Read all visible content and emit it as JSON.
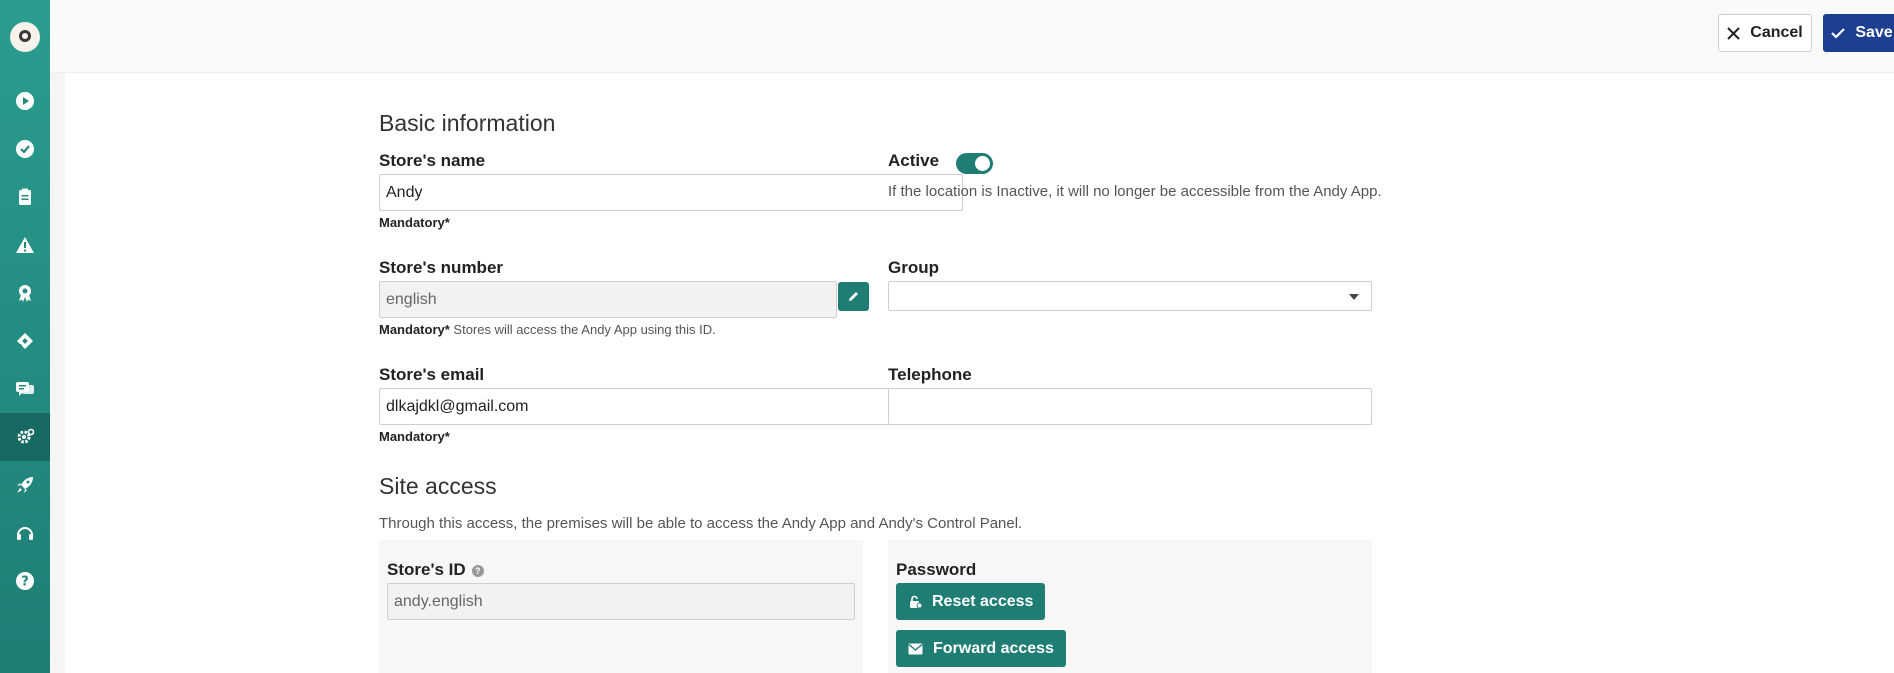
{
  "sidebar": {
    "logo_icon": "dog-logo-icon",
    "items": [
      {
        "name": "play-icon",
        "active": false
      },
      {
        "name": "check-circle-icon",
        "active": false
      },
      {
        "name": "clipboard-icon",
        "active": false
      },
      {
        "name": "warning-icon",
        "active": false
      },
      {
        "name": "award-icon",
        "active": false
      },
      {
        "name": "ticket-icon",
        "active": false
      },
      {
        "name": "chat-icon",
        "active": false
      },
      {
        "name": "gear-icon",
        "active": true
      },
      {
        "name": "rocket-icon",
        "active": false
      },
      {
        "name": "headset-icon",
        "active": false
      },
      {
        "name": "help-icon",
        "active": false
      }
    ]
  },
  "toolbar": {
    "cancel_label": "Cancel",
    "save_label": "Save"
  },
  "basic_info": {
    "title": "Basic information",
    "store_name": {
      "label": "Store's name",
      "value": "Andy",
      "helper": "Mandatory*"
    },
    "active": {
      "label": "Active",
      "enabled": true,
      "hint": "If the location is Inactive, it will no longer be accessible from the Andy App."
    },
    "store_number": {
      "label": "Store's number",
      "value": "english",
      "helper_bold": "Mandatory*",
      "helper_rest": " Stores will access the Andy App using this ID."
    },
    "group": {
      "label": "Group",
      "value": ""
    },
    "store_email": {
      "label": "Store's email",
      "value": "dlkajdkl@gmail.com",
      "helper": "Mandatory*"
    },
    "telephone": {
      "label": "Telephone",
      "value": ""
    }
  },
  "site_access": {
    "title": "Site access",
    "description": "Through this access, the premises will be able to access the Andy App and Andy's Control Panel.",
    "store_id": {
      "label": "Store's ID",
      "value": "andy.english"
    },
    "password": {
      "label": "Password"
    },
    "reset_label": "Reset access",
    "forward_label": "Forward access"
  },
  "colors": {
    "sidebar": "#2a9d8f",
    "accent": "#1f7d74",
    "primary": "#1c3f8f"
  }
}
